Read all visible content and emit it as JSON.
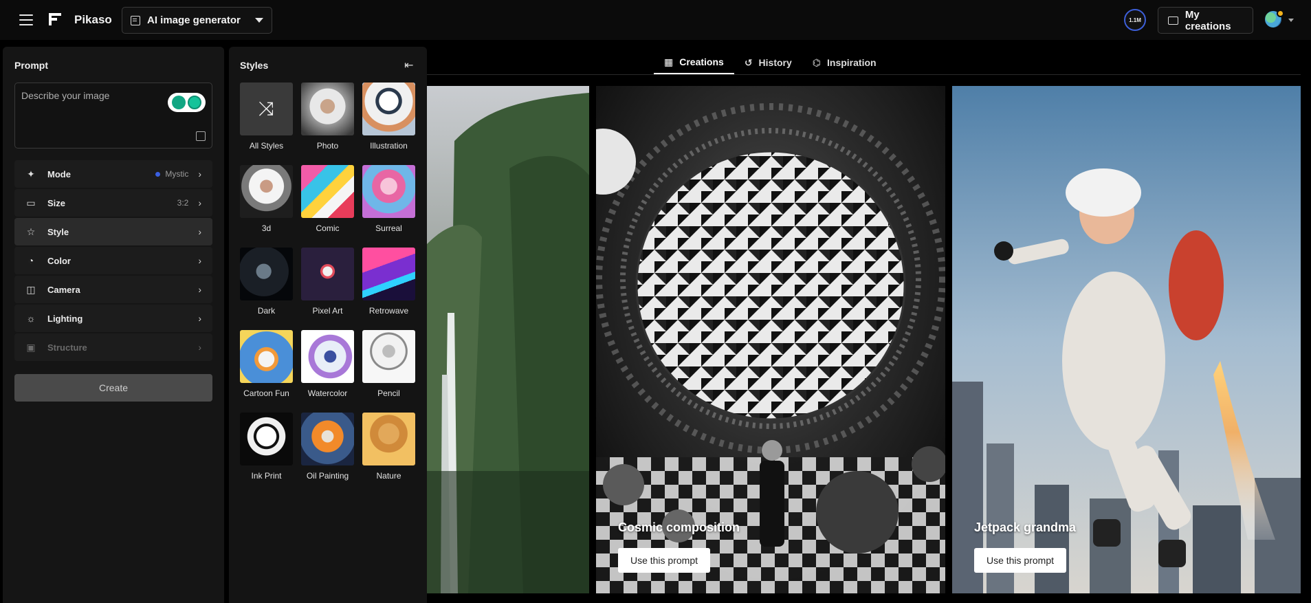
{
  "header": {
    "app_name": "Pikaso",
    "generator_select": "AI image generator",
    "credits_badge": "1.1M",
    "my_creations": "My creations"
  },
  "prompt_panel": {
    "title": "Prompt",
    "placeholder": "Describe your image",
    "settings": [
      {
        "label": "Mode",
        "value": "Mystic",
        "icon": "sparkle-icon"
      },
      {
        "label": "Size",
        "value": "3:2",
        "icon": "aspect-ratio-icon"
      },
      {
        "label": "Style",
        "value": "",
        "icon": "style-icon"
      },
      {
        "label": "Color",
        "value": "",
        "icon": "palette-icon"
      },
      {
        "label": "Camera",
        "value": "",
        "icon": "camera-icon"
      },
      {
        "label": "Lighting",
        "value": "",
        "icon": "sun-icon"
      },
      {
        "label": "Structure",
        "value": "",
        "icon": "structure-icon"
      }
    ],
    "create_button": "Create"
  },
  "styles_panel": {
    "title": "Styles",
    "styles": [
      "All Styles",
      "Photo",
      "Illustration",
      "3d",
      "Comic",
      "Surreal",
      "Dark",
      "Pixel Art",
      "Retrowave",
      "Cartoon Fun",
      "Watercolor",
      "Pencil",
      "Ink Print",
      "Oil Painting",
      "Nature"
    ]
  },
  "tabs": [
    {
      "label": "Creations",
      "active": true
    },
    {
      "label": "History",
      "active": false
    },
    {
      "label": "Inspiration",
      "active": false
    }
  ],
  "gallery": {
    "cards": [
      {
        "title": "",
        "button": ""
      },
      {
        "title": "Cosmic composition",
        "button": "Use this prompt"
      },
      {
        "title": "Jetpack grandma",
        "button": "Use this prompt"
      }
    ]
  },
  "colors": {
    "accent_blue": "#3a5fe0",
    "panel_bg": "#151515",
    "create_button_bg": "#4a4a4a"
  }
}
